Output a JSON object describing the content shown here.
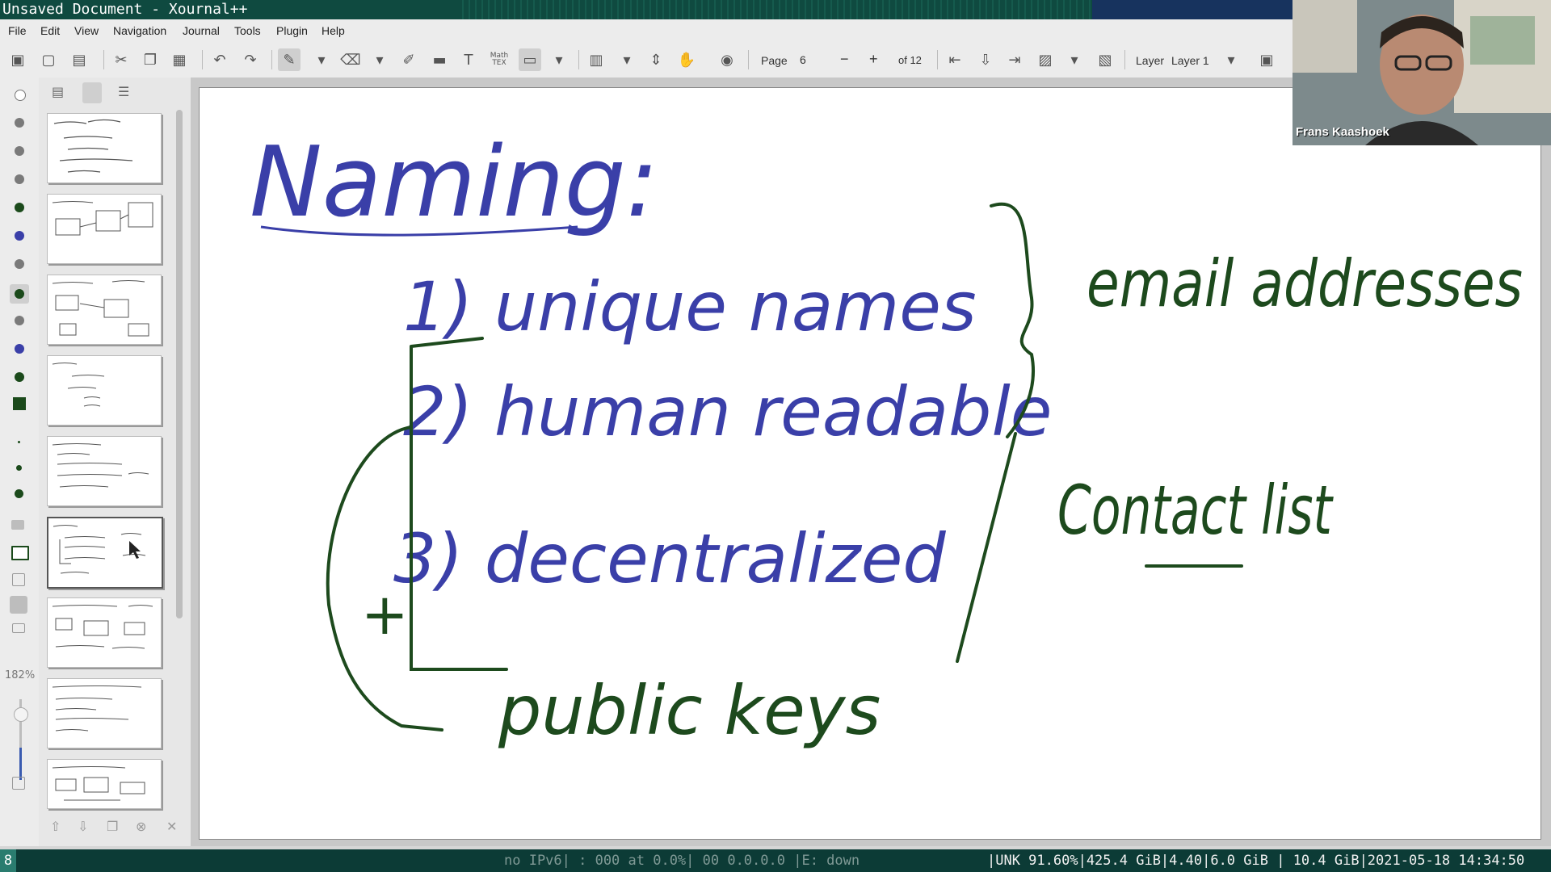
{
  "window": {
    "title": "Unsaved Document - Xournal++"
  },
  "menu": [
    "File",
    "Edit",
    "View",
    "Navigation",
    "Journal",
    "Tools",
    "Plugin",
    "Help"
  ],
  "toolbar": {
    "page_label": "Page",
    "page_value": "6",
    "page_of": "of 12",
    "layer_label": "Layer",
    "layer_value": "Layer 1",
    "math_label": "Math TEX",
    "text_tool_glyph": "T"
  },
  "sidebar": {
    "zoom": "182%",
    "selected_page": 6,
    "page_count_visible": 9
  },
  "webcam": {
    "name": "Frans Kaashoek"
  },
  "note": {
    "title": "Naming:",
    "items": [
      "1) unique names",
      "2) human readable",
      "3) decentralized"
    ],
    "left_annotation": "public keys",
    "right_annotation_1": "email addresses",
    "right_annotation_2": "Contact list",
    "plus_mark": "+"
  },
  "statusbar": {
    "workspace": "8",
    "dim_text": "no IPv6|     : 000 at 0.0%|  00  0.0.0.0   |E: down",
    "bright_text": "|UNK 91.60%|425.4 GiB|4.40|6.0 GiB | 10.4 GiB|2021-05-18 14:34:50"
  },
  "colors": {
    "ink_blue": "#3a3fa8",
    "ink_green": "#1d4a1d",
    "titlebar": "#0f4a40",
    "statusbar": "#0c3b36"
  }
}
